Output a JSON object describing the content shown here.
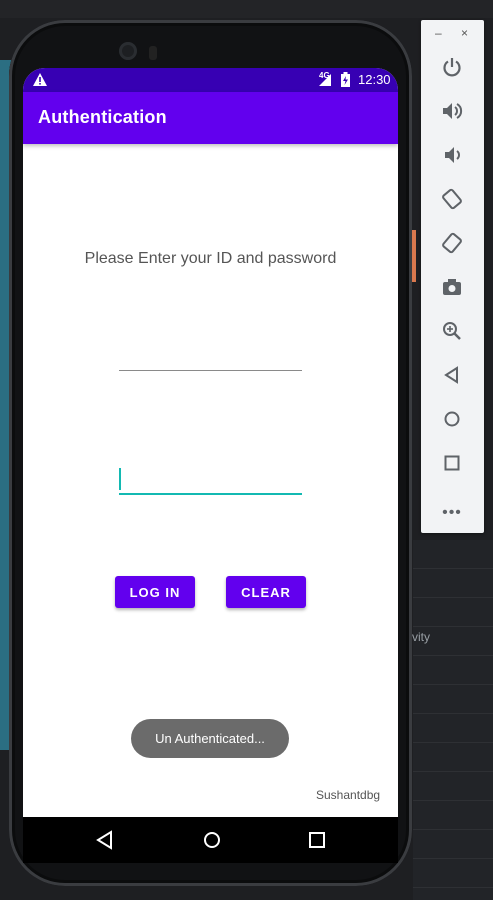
{
  "status_bar": {
    "network": "4G",
    "time": "12:30"
  },
  "app_bar": {
    "title": "Authentication"
  },
  "content": {
    "prompt": "Please Enter your ID and password",
    "id_field": {
      "value": "",
      "placeholder": ""
    },
    "password_field": {
      "value": "",
      "placeholder": ""
    },
    "login_label": "LOG IN",
    "clear_label": "CLEAR",
    "footer": "Sushantdbg"
  },
  "toast": {
    "message": "Un Authenticated..."
  },
  "background": {
    "fragment_text": "vity"
  },
  "emulator_toolbar": {
    "minimize_label": "–",
    "close_label": "×",
    "more_label": "•••",
    "icons": [
      "power-icon",
      "volume-up-icon",
      "volume-down-icon",
      "rotate-left-icon",
      "rotate-right-icon",
      "camera-icon",
      "zoom-icon",
      "back-icon",
      "home-icon",
      "overview-icon",
      "more-icon"
    ]
  },
  "colors": {
    "primary": "#6200ee",
    "primary_dark": "#3700b3",
    "accent": "#13b9b2",
    "toast": "#6b6b6b"
  }
}
